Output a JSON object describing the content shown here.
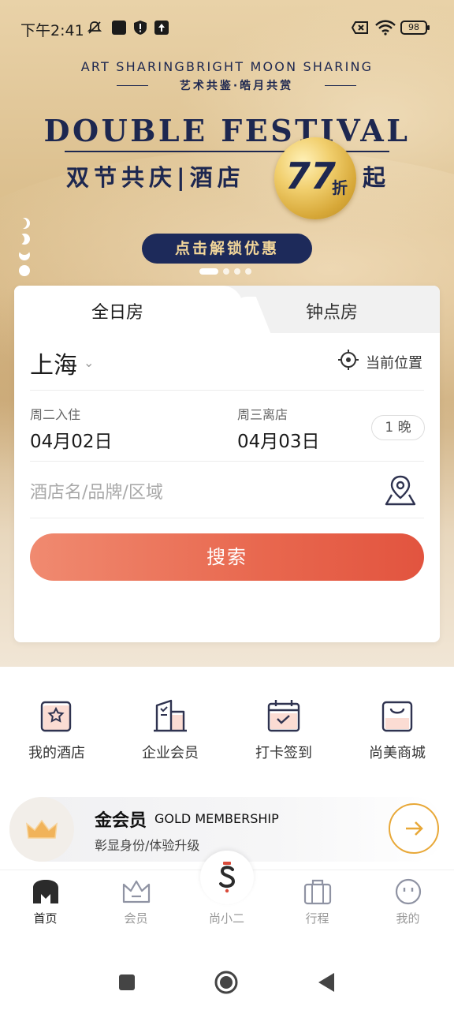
{
  "status_bar": {
    "time": "下午2:41",
    "battery": "98"
  },
  "banner": {
    "art_title": "ART SHARINGBRIGHT MOON SHARING",
    "art_subtitle": "艺术共鉴·皓月共赏",
    "festival_title": "DOUBLE FESTIVAL",
    "promo_text": "双节共庆|酒店",
    "discount_number": "77",
    "discount_unit": "折",
    "promo_suffix": "起",
    "unlock_label": "点击解锁优惠"
  },
  "booking": {
    "tabs": [
      {
        "label": "全日房",
        "active": true
      },
      {
        "label": "钟点房",
        "active": false
      }
    ],
    "city": "上海",
    "current_location_label": "当前位置",
    "checkin_label": "周二入住",
    "checkin_date": "04月02日",
    "checkout_label": "周三离店",
    "checkout_date": "04月03日",
    "nights": "1 晚",
    "hotel_placeholder": "酒店名/品牌/区域",
    "search_label": "搜索"
  },
  "quick_menu": [
    {
      "label": "我的酒店",
      "icon": "hotel-star-icon"
    },
    {
      "label": "企业会员",
      "icon": "building-icon"
    },
    {
      "label": "打卡签到",
      "icon": "calendar-check-icon"
    },
    {
      "label": "尚美商城",
      "icon": "shopping-bag-icon"
    }
  ],
  "gold_membership": {
    "title": "金会员",
    "title_en": "GOLD MEMBERSHIP",
    "subtitle": "彰显身份/体验升级"
  },
  "bottom_nav": [
    {
      "label": "首页",
      "icon": "home-icon",
      "active": true
    },
    {
      "label": "会员",
      "icon": "crown-icon",
      "active": false
    },
    {
      "label": "尚小二",
      "icon": "brand-s-icon",
      "active": false
    },
    {
      "label": "行程",
      "icon": "suitcase-icon",
      "active": false
    },
    {
      "label": "我的",
      "icon": "face-icon",
      "active": false
    }
  ],
  "colors": {
    "navy": "#1d2750",
    "search_gradient_start": "#f08a70",
    "search_gradient_end": "#e2543f",
    "gold_accent": "#e8a838"
  }
}
